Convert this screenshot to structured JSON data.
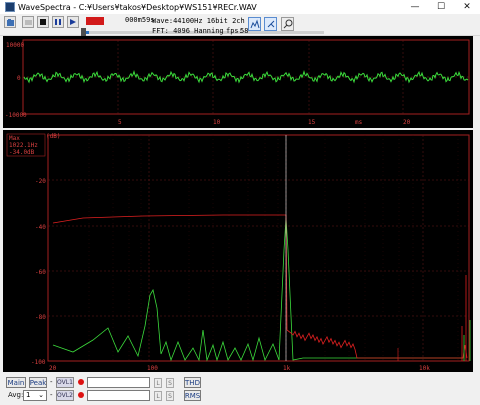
{
  "window": {
    "title": "WaveSpectra - C:¥Users¥takos¥Desktop¥WS151¥RECr.WAV",
    "minimize": "—",
    "maximize": "☐",
    "close": "✕"
  },
  "toolbar": {
    "time": "000m59s",
    "wave_info": "Wave:44100Hz 16bit 2ch",
    "fft_info": "FFT: 4096 Hanning",
    "fps_label": "fps:",
    "fps_value": "58",
    "progress": 0.02,
    "buttons": [
      "open-icon",
      "record-icon",
      "stop-icon",
      "pause-icon",
      "play-icon"
    ],
    "tool_icons": [
      "spectrum-icon",
      "settings-icon",
      "zoom-icon"
    ]
  },
  "wave": {
    "y_ticks": [
      "10000",
      "0",
      "-10000"
    ],
    "x_ticks": [
      "5",
      "10",
      "15",
      "20"
    ],
    "x_unit": "ms",
    "line_color": "#3cdc3c"
  },
  "spectrum": {
    "readout_mode": "Max",
    "readout_freq": "1022.1Hz",
    "readout_level": "-34.0dB",
    "y_unit": "(dB)",
    "y_ticks": [
      "-20",
      "-40",
      "-60",
      "-80",
      "-100"
    ],
    "x_ticks": [
      "20",
      "100",
      "1k",
      "10k"
    ],
    "colors": {
      "left": "#3cdc3c",
      "right": "#e02020",
      "grid": "#8a2020"
    }
  },
  "bottom": {
    "main": "Main",
    "peak": "Peak",
    "ovl1": "OVL1",
    "ovl2": "OVL2",
    "avg_label": "Avg:",
    "avg_value": "1",
    "l": "L",
    "s": "S",
    "thd": "THD",
    "rms": "RMS"
  }
}
